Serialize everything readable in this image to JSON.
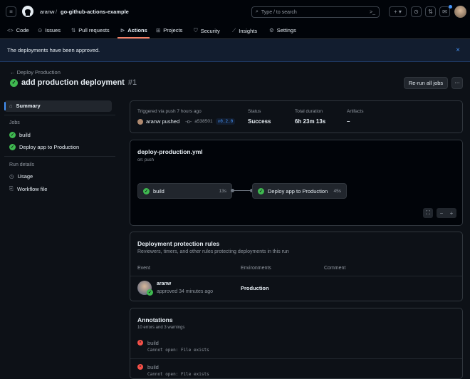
{
  "header": {
    "owner": "aranw",
    "separator": "/",
    "repo": "go-github-actions-example",
    "search_placeholder": "Type / to search"
  },
  "tabs": [
    {
      "label": "Code",
      "icon": "code-icon"
    },
    {
      "label": "Issues",
      "icon": "issue-icon"
    },
    {
      "label": "Pull requests",
      "icon": "pull-request-icon"
    },
    {
      "label": "Actions",
      "icon": "play-icon",
      "active": true
    },
    {
      "label": "Projects",
      "icon": "table-icon"
    },
    {
      "label": "Security",
      "icon": "shield-icon"
    },
    {
      "label": "Insights",
      "icon": "graph-icon"
    },
    {
      "label": "Settings",
      "icon": "gear-icon"
    }
  ],
  "banner": {
    "message": "The deployments have been approved.",
    "close": "×"
  },
  "run": {
    "workflow_link": "Deploy Production",
    "title": "add production deployment",
    "number": "#1",
    "rerun_label": "Re-run all jobs",
    "more": "···"
  },
  "sidebar": {
    "summary": "Summary",
    "jobs_heading": "Jobs",
    "jobs": [
      "build",
      "Deploy app to Production"
    ],
    "run_details_heading": "Run details",
    "details": [
      "Usage",
      "Workflow file"
    ]
  },
  "summary": {
    "trigger_label": "Triggered via push 7 hours ago",
    "actor": "aranw pushed",
    "commit": "a538501",
    "tag": "v0.2.0",
    "status_label": "Status",
    "status": "Success",
    "duration_label": "Total duration",
    "duration": "6h 23m 13s",
    "artifacts_label": "Artifacts",
    "artifacts": "–"
  },
  "graph": {
    "file": "deploy-production.yml",
    "trigger": "on: push",
    "jobs": [
      {
        "name": "build",
        "time": "13s"
      },
      {
        "name": "Deploy app to Production",
        "time": "45s"
      }
    ]
  },
  "protection": {
    "title": "Deployment protection rules",
    "subtitle": "Reviewers, timers, and other rules protecting deployments in this run",
    "columns": [
      "Event",
      "Environments",
      "Comment"
    ],
    "rows": [
      {
        "user": "aranw",
        "event": "approved 34 minutes ago",
        "environment": "Production",
        "comment": ""
      }
    ]
  },
  "annotations": {
    "title": "Annotations",
    "subtitle": "10 errors and 3 warnings",
    "items": [
      {
        "job": "build",
        "message": "Cannot open: File exists"
      },
      {
        "job": "build",
        "message": "Cannot open: File exists"
      }
    ]
  },
  "colors": {
    "accent": "#f78166",
    "success": "#3fb950",
    "error": "#f85149",
    "link": "#4493f8"
  }
}
